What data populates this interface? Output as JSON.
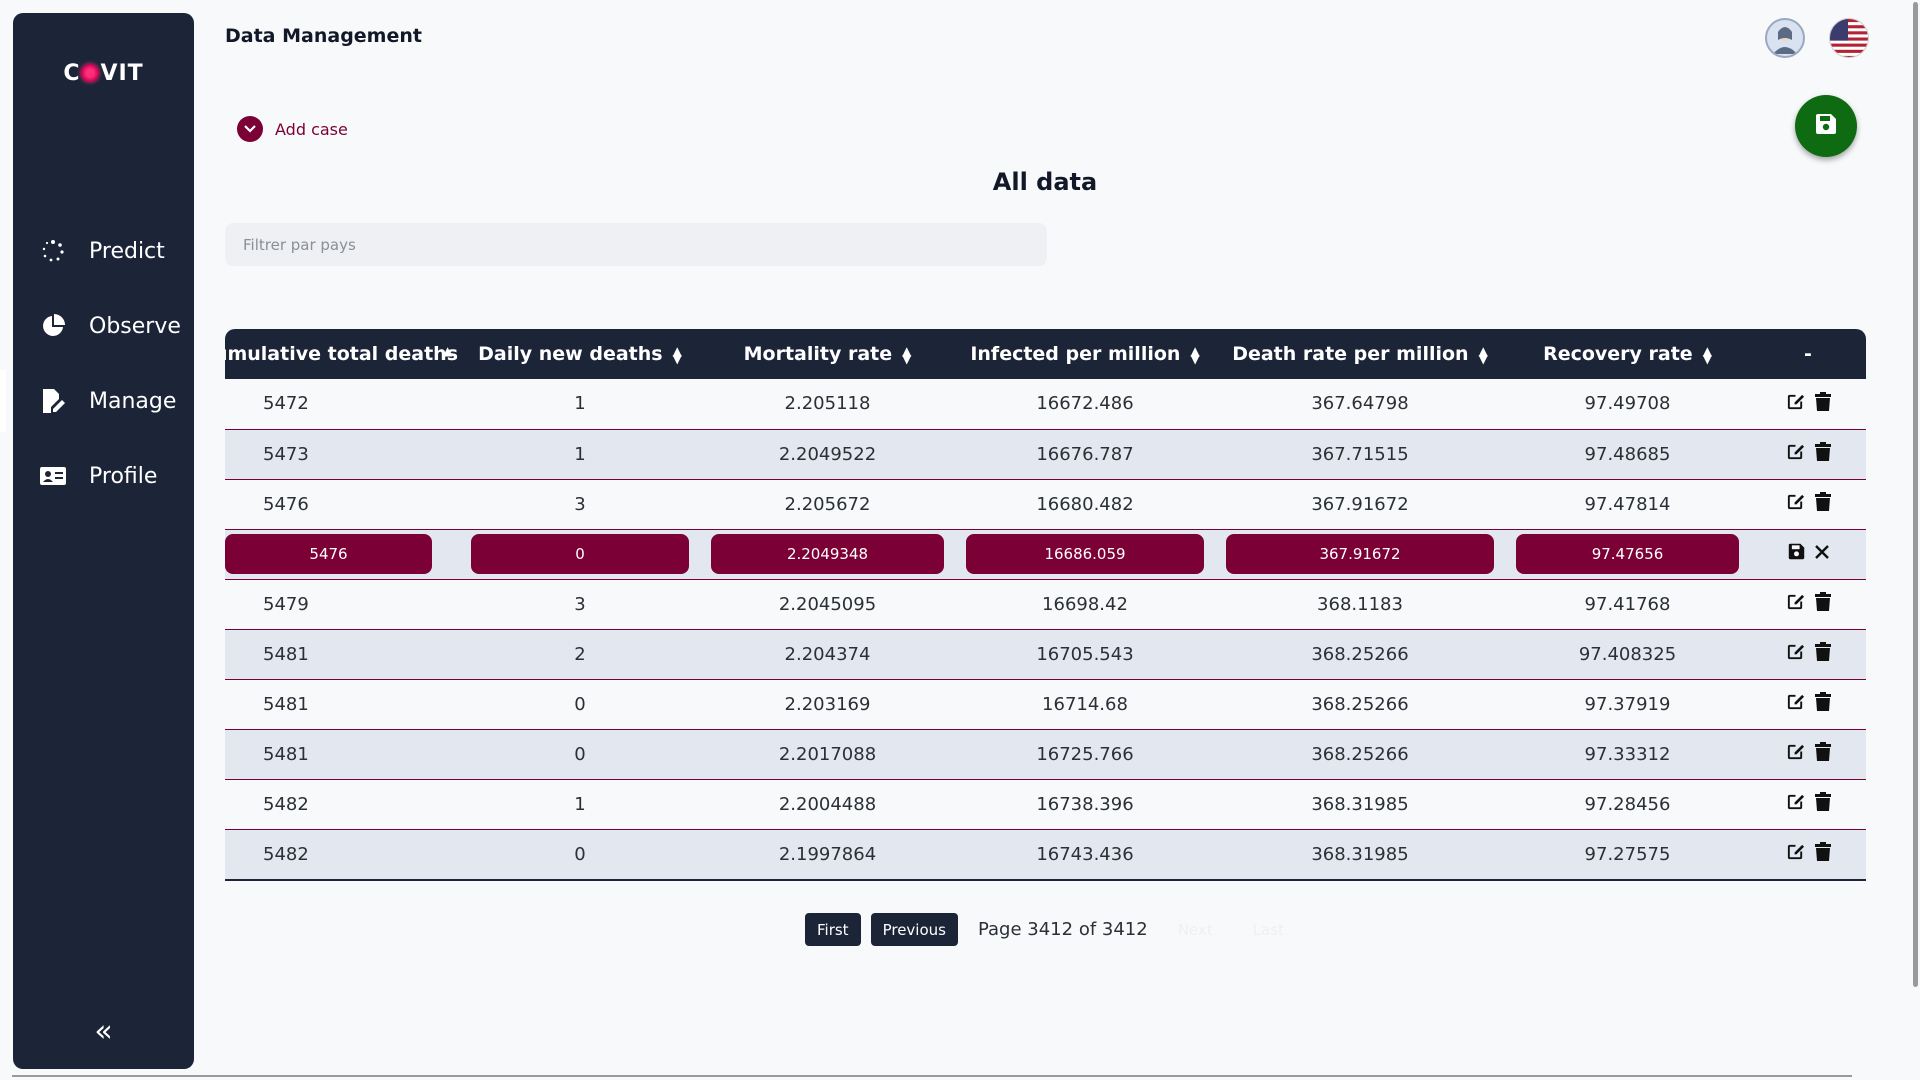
{
  "sidebar": {
    "logo_left": "C",
    "logo_right": "VIT",
    "items": [
      {
        "label": "Predict",
        "icon": "spinner-icon"
      },
      {
        "label": "Observe",
        "icon": "pie-chart-icon"
      },
      {
        "label": "Manage",
        "icon": "edit-document-icon"
      },
      {
        "label": "Profile",
        "icon": "id-card-icon"
      }
    ],
    "active": "Manage",
    "collapse_label": "«"
  },
  "header": {
    "title": "Data Management"
  },
  "actions": {
    "add_case_label": "Add case"
  },
  "main": {
    "section_title": "All data",
    "filter_placeholder": "Filtrer par pays"
  },
  "table": {
    "columns": [
      "Cumulative total deaths",
      "Daily new deaths",
      "Mortality rate",
      "Infected per million",
      "Death rate per million",
      "Recovery rate",
      "-"
    ],
    "rows": [
      [
        "5472",
        "1",
        "2.205118",
        "16672.486",
        "367.64798",
        "97.49708"
      ],
      [
        "5473",
        "1",
        "2.2049522",
        "16676.787",
        "367.71515",
        "97.48685"
      ],
      [
        "5476",
        "3",
        "2.205672",
        "16680.482",
        "367.91672",
        "97.47814"
      ],
      [
        "5476",
        "0",
        "2.2049348",
        "16686.059",
        "367.91672",
        "97.47656"
      ],
      [
        "5479",
        "3",
        "2.2045095",
        "16698.42",
        "368.1183",
        "97.41768"
      ],
      [
        "5481",
        "2",
        "2.204374",
        "16705.543",
        "368.25266",
        "97.408325"
      ],
      [
        "5481",
        "0",
        "2.203169",
        "16714.68",
        "368.25266",
        "97.37919"
      ],
      [
        "5481",
        "0",
        "2.2017088",
        "16725.766",
        "368.25266",
        "97.33312"
      ],
      [
        "5482",
        "1",
        "2.2004488",
        "16738.396",
        "368.31985",
        "97.28456"
      ],
      [
        "5482",
        "0",
        "2.1997864",
        "16743.436",
        "368.31985",
        "97.27575"
      ]
    ],
    "editing_row_index": 3
  },
  "pager": {
    "first": "First",
    "previous": "Previous",
    "info": "Page 3412 of 3412",
    "next": "Next",
    "last": "Last"
  },
  "colors": {
    "sidebar_bg": "#1c2538",
    "accent": "#7a0036",
    "save_green": "#0e6b12"
  }
}
